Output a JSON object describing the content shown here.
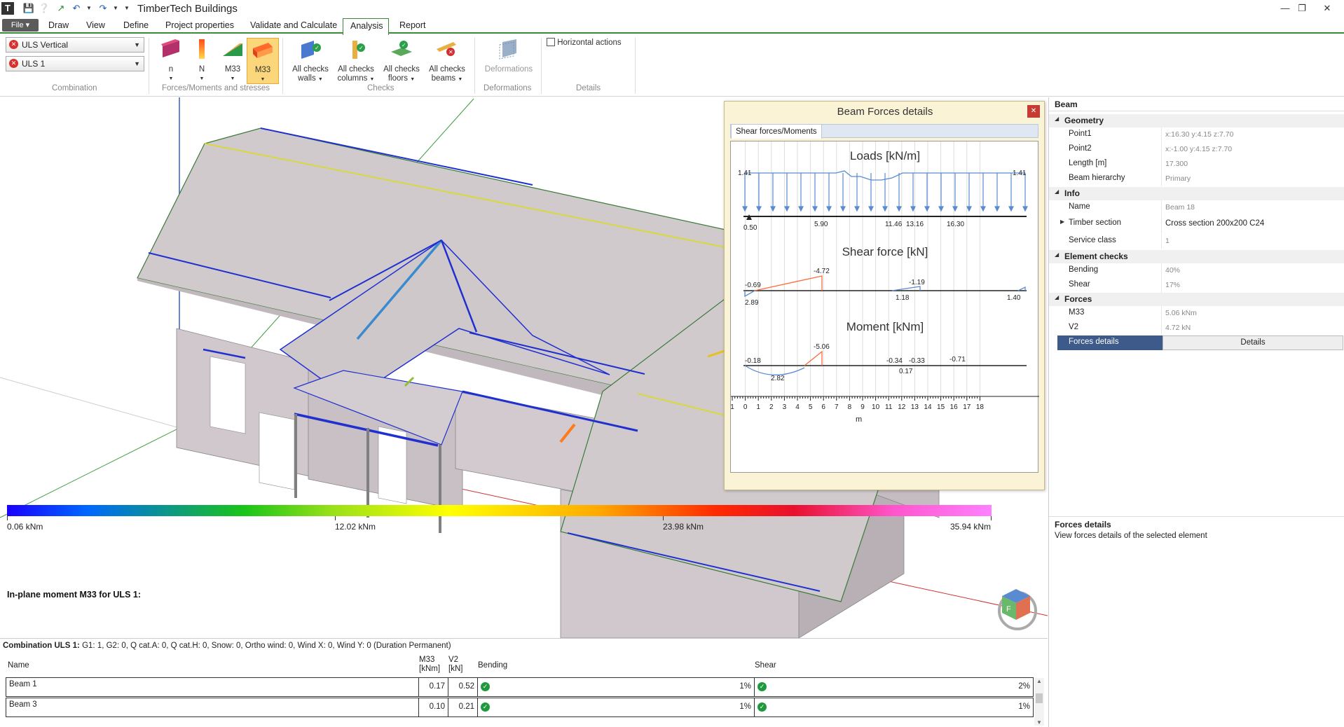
{
  "app": {
    "title": "TimberTech Buildings"
  },
  "menu": {
    "file": "File",
    "items": [
      "Draw",
      "View",
      "Define",
      "Project properties",
      "Validate and Calculate",
      "Analysis",
      "Report"
    ]
  },
  "ribbon": {
    "combination": {
      "select1": "ULS Vertical",
      "select2": "ULS 1",
      "label": "Combination"
    },
    "forces": {
      "buttons": [
        "n",
        "N",
        "M33",
        "M33"
      ],
      "label": "Forces/Moments and stresses"
    },
    "checks": {
      "buttons": [
        {
          "line1": "All checks",
          "line2": "walls"
        },
        {
          "line1": "All checks",
          "line2": "columns"
        },
        {
          "line1": "All checks",
          "line2": "floors"
        },
        {
          "line1": "All checks",
          "line2": "beams"
        }
      ],
      "label": "Checks"
    },
    "deformations": {
      "button": "Deformations",
      "label": "Deformations"
    },
    "details": {
      "button": "Horizontal actions",
      "label": "Details"
    }
  },
  "viewport": {
    "legend_title": "In-plane moment M33 for ULS 1:",
    "legend_ticks": [
      "0.06 kNm",
      "12.02 kNm",
      "23.98 kNm",
      "35.94 kNm"
    ],
    "colors": {
      "low": "#1a00ff",
      "mid": "#ffff00",
      "high": "#ff80ff"
    }
  },
  "popup": {
    "title": "Beam Forces details",
    "tab": "Shear forces/Moments",
    "loads_title": "Loads [kN/m]",
    "load_end_values": [
      "1.41",
      "1.41"
    ],
    "load_positions": [
      "0.50",
      "5.90",
      "11.46",
      "13.16",
      "16.30"
    ],
    "shear_title": "Shear force [kN]",
    "shear_labels": [
      "-0.69",
      "-4.72",
      "-1.19",
      "2.89",
      "1.18",
      "1.40"
    ],
    "moment_title": "Moment [kNm]",
    "moment_labels": [
      "-0.18",
      "-5.06",
      "-0.34",
      "-0.33",
      "-0.71",
      "2.82",
      "0.17"
    ],
    "axis_ticks": [
      "1",
      "0",
      "1",
      "2",
      "3",
      "4",
      "5",
      "6",
      "7",
      "8",
      "9",
      "10",
      "11",
      "12",
      "13",
      "14",
      "15",
      "16",
      "17",
      "18"
    ],
    "axis_unit": "m"
  },
  "props": {
    "header": "Beam",
    "sections": {
      "geometry": "Geometry",
      "info": "Info",
      "element_checks": "Element checks",
      "forces": "Forces"
    },
    "geometry": [
      {
        "name": "Point1",
        "value": "x:16.30 y:4.15 z:7.70"
      },
      {
        "name": "Point2",
        "value": "x:-1.00 y:4.15 z:7.70"
      },
      {
        "name": "Length [m]",
        "value": "17.300"
      },
      {
        "name": "Beam hierarchy",
        "value": "Primary"
      }
    ],
    "info": [
      {
        "name": "Name",
        "value": "Beam 18"
      },
      {
        "name": "Timber section",
        "value": "Cross section 200x200 C24"
      },
      {
        "name": "Service class",
        "value": "1"
      }
    ],
    "element_checks": [
      {
        "name": "Bending",
        "value": "40%"
      },
      {
        "name": "Shear",
        "value": "17%"
      }
    ],
    "forces": [
      {
        "name": "M33",
        "value": "5.06 kNm"
      },
      {
        "name": "V2",
        "value": "4.72 kN"
      }
    ],
    "forces_details": {
      "name": "Forces details",
      "button": "Details"
    },
    "description": {
      "title": "Forces details",
      "text": "View forces details of the selected element"
    }
  },
  "bottom": {
    "combination_label": "Combination ULS 1:",
    "combination_text": "G1: 1, G2: 0, Q cat.A: 0, Q cat.H: 0, Snow: 0, Ortho wind: 0, Wind X: 0, Wind Y: 0 (Duration Permanent)",
    "columns": {
      "name": "Name",
      "m33": "M33",
      "m33_unit": "[kNm]",
      "v2": "V2",
      "v2_unit": "[kN]",
      "bending": "Bending",
      "shear": "Shear"
    },
    "rows": [
      {
        "name": "Beam 1",
        "m33": "0.17",
        "v2": "0.52",
        "bending": "1%",
        "shear": "2%"
      },
      {
        "name": "Beam 3",
        "m33": "0.10",
        "v2": "0.21",
        "bending": "1%",
        "shear": "1%"
      }
    ]
  }
}
